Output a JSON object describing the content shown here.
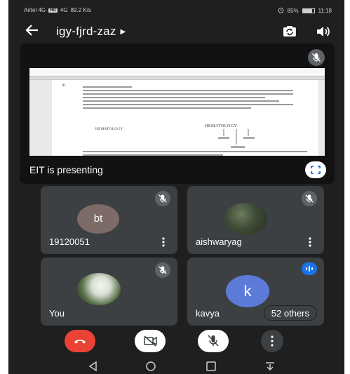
{
  "status_bar": {
    "carrier": "Airtel 4G",
    "network_badge": "HD",
    "network_type": "4G",
    "speed": "89.2 K/s",
    "battery_percent": "85%",
    "battery_level": 0.85,
    "time": "11:18"
  },
  "app_bar": {
    "meeting_code": "igy-fjrd-zaz",
    "icons": [
      "back-arrow",
      "switch-camera",
      "speaker"
    ]
  },
  "presentation": {
    "label": "EIT is presenting",
    "doc_number": "III.",
    "doc_heading": "HEMATOLOGY",
    "doc_heading_2": "HEMATOLOGY"
  },
  "participants": [
    {
      "name": "19120051",
      "initials": "bt",
      "muted": true
    },
    {
      "name": "aishwaryag",
      "muted": true
    },
    {
      "name": "You",
      "muted": true
    },
    {
      "name": "kavya",
      "initials": "k",
      "speaking": true,
      "others": "52 others"
    }
  ],
  "controls": [
    "end-call",
    "camera-off",
    "mic-off",
    "more-options"
  ],
  "nav": [
    "back",
    "home",
    "recents",
    "notifications"
  ],
  "colors": {
    "background": "#1f1f1f",
    "tile": "#3c4043",
    "end_call": "#ea4335",
    "accent_blue": "#1a73e8",
    "avatar_k": "#5c7bd9",
    "avatar_bt": "#7d6b67"
  }
}
